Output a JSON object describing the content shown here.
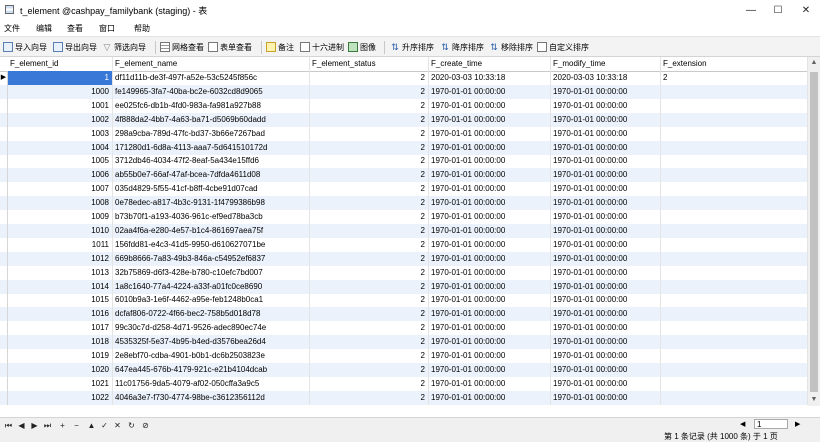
{
  "window": {
    "title": "t_element @cashpay_familybank (staging) - 表",
    "minimize": "—",
    "maximize": "☐",
    "close": "✕"
  },
  "menu": [
    "文件",
    "编辑",
    "查看",
    "窗口",
    "帮助"
  ],
  "toolbar": {
    "import_wizard": "导入向导",
    "export_wizard": "导出向导",
    "filter_wizard": "筛选向导",
    "grid_view": "网格查看",
    "form_view": "表单查看",
    "memo": "备注",
    "hex": "十六进制",
    "image": "图像",
    "sort_asc": "升序排序",
    "sort_desc": "降序排序",
    "remove_sort": "移除排序",
    "custom_sort": "自定义排序"
  },
  "columns": [
    "F_element_id",
    "F_element_name",
    "F_element_status",
    "F_create_time",
    "F_modify_time",
    "F_extension"
  ],
  "rows": [
    [
      "1",
      "df11d11b-de3f-497f-a52e-53c5245f856c",
      "2",
      "2020-03-03 10:33:18",
      "2020-03-03 10:33:18",
      "2"
    ],
    [
      "1000",
      "fe149965-3fa7-40ba-bc2e-6032cd8d9065",
      "2",
      "1970-01-01 00:00:00",
      "1970-01-01 00:00:00",
      ""
    ],
    [
      "1001",
      "ee025fc6-db1b-4fd0-983a-fa981a927b88",
      "2",
      "1970-01-01 00:00:00",
      "1970-01-01 00:00:00",
      ""
    ],
    [
      "1002",
      "4f888da2-4bb7-4a63-ba71-d5069b60dadd",
      "2",
      "1970-01-01 00:00:00",
      "1970-01-01 00:00:00",
      ""
    ],
    [
      "1003",
      "298a9cba-789d-47fc-bd37-3b66e7267bad",
      "2",
      "1970-01-01 00:00:00",
      "1970-01-01 00:00:00",
      ""
    ],
    [
      "1004",
      "171280d1-6d8a-4113-aaa7-5d641510172d",
      "2",
      "1970-01-01 00:00:00",
      "1970-01-01 00:00:00",
      ""
    ],
    [
      "1005",
      "3712db46-4034-47f2-8eaf-5a434e15ffd6",
      "2",
      "1970-01-01 00:00:00",
      "1970-01-01 00:00:00",
      ""
    ],
    [
      "1006",
      "ab55b0e7-66af-47af-bcea-7dfda4611d08",
      "2",
      "1970-01-01 00:00:00",
      "1970-01-01 00:00:00",
      ""
    ],
    [
      "1007",
      "035d4829-5f55-41cf-b8ff-4cbe91d07cad",
      "2",
      "1970-01-01 00:00:00",
      "1970-01-01 00:00:00",
      ""
    ],
    [
      "1008",
      "0e78edec-a817-4b3c-9131-1f4799386b98",
      "2",
      "1970-01-01 00:00:00",
      "1970-01-01 00:00:00",
      ""
    ],
    [
      "1009",
      "b73b70f1-a193-4036-961c-ef9ed78ba3cb",
      "2",
      "1970-01-01 00:00:00",
      "1970-01-01 00:00:00",
      ""
    ],
    [
      "1010",
      "02aa4f6a-e280-4e57-b1c4-861697aea75f",
      "2",
      "1970-01-01 00:00:00",
      "1970-01-01 00:00:00",
      ""
    ],
    [
      "1011",
      "156fdd81-e4c3-41d5-9950-d610627071be",
      "2",
      "1970-01-01 00:00:00",
      "1970-01-01 00:00:00",
      ""
    ],
    [
      "1012",
      "669b8666-7a83-49b3-846a-c54952ef6837",
      "2",
      "1970-01-01 00:00:00",
      "1970-01-01 00:00:00",
      ""
    ],
    [
      "1013",
      "32b75869-d6f3-428e-b780-c10efc7bd007",
      "2",
      "1970-01-01 00:00:00",
      "1970-01-01 00:00:00",
      ""
    ],
    [
      "1014",
      "1a8c1640-77a4-4224-a33f-a01fc0ce8690",
      "2",
      "1970-01-01 00:00:00",
      "1970-01-01 00:00:00",
      ""
    ],
    [
      "1015",
      "6010b9a3-1e6f-4462-a95e-feb1248b0ca1",
      "2",
      "1970-01-01 00:00:00",
      "1970-01-01 00:00:00",
      ""
    ],
    [
      "1016",
      "dcfaf806-0722-4f66-bec2-758b5d018d78",
      "2",
      "1970-01-01 00:00:00",
      "1970-01-01 00:00:00",
      ""
    ],
    [
      "1017",
      "99c30c7d-d258-4d71-9526-adec890ec74e",
      "2",
      "1970-01-01 00:00:00",
      "1970-01-01 00:00:00",
      ""
    ],
    [
      "1018",
      "4535325f-5e37-4b95-b4ed-d3576bea26d4",
      "2",
      "1970-01-01 00:00:00",
      "1970-01-01 00:00:00",
      ""
    ],
    [
      "1019",
      "2e8ebf70-cdba-4901-b0b1-dc6b2503823e",
      "2",
      "1970-01-01 00:00:00",
      "1970-01-01 00:00:00",
      ""
    ],
    [
      "1020",
      "647ea445-676b-4179-921c-e21b4104dcab",
      "2",
      "1970-01-01 00:00:00",
      "1970-01-01 00:00:00",
      ""
    ],
    [
      "1021",
      "11c01756-9da5-4079-af02-050cffa3a9c5",
      "2",
      "1970-01-01 00:00:00",
      "1970-01-01 00:00:00",
      ""
    ],
    [
      "1022",
      "4046a3e7-f730-4774-98be-c3612356112d",
      "2",
      "1970-01-01 00:00:00",
      "1970-01-01 00:00:00",
      ""
    ]
  ],
  "selected_row": 0,
  "current_row_marker": "▶",
  "nav_buttons": [
    {
      "icon": "first-record-icon",
      "glyph": "⏮"
    },
    {
      "icon": "prev-record-icon",
      "glyph": "◀"
    },
    {
      "icon": "next-record-icon",
      "glyph": "▶"
    },
    {
      "icon": "last-record-icon",
      "glyph": "⏭"
    },
    {
      "icon": "add-record-icon",
      "glyph": "+"
    },
    {
      "icon": "delete-record-icon",
      "glyph": "−"
    },
    {
      "icon": "up-icon",
      "glyph": "▲"
    },
    {
      "icon": "check-icon",
      "glyph": "✓"
    },
    {
      "icon": "cancel-icon",
      "glyph": "✕"
    },
    {
      "icon": "refresh-icon",
      "glyph": "↻"
    },
    {
      "icon": "stop-icon",
      "glyph": "⊘"
    }
  ],
  "status": {
    "record_text": "第 1 条记录 (共 1000 条) 于 1 页",
    "page_number": "1"
  },
  "colors": {
    "selected_cell": "#3a78d8",
    "alt_row": "#ebf2fb",
    "header_border": "#c9c9c9"
  }
}
